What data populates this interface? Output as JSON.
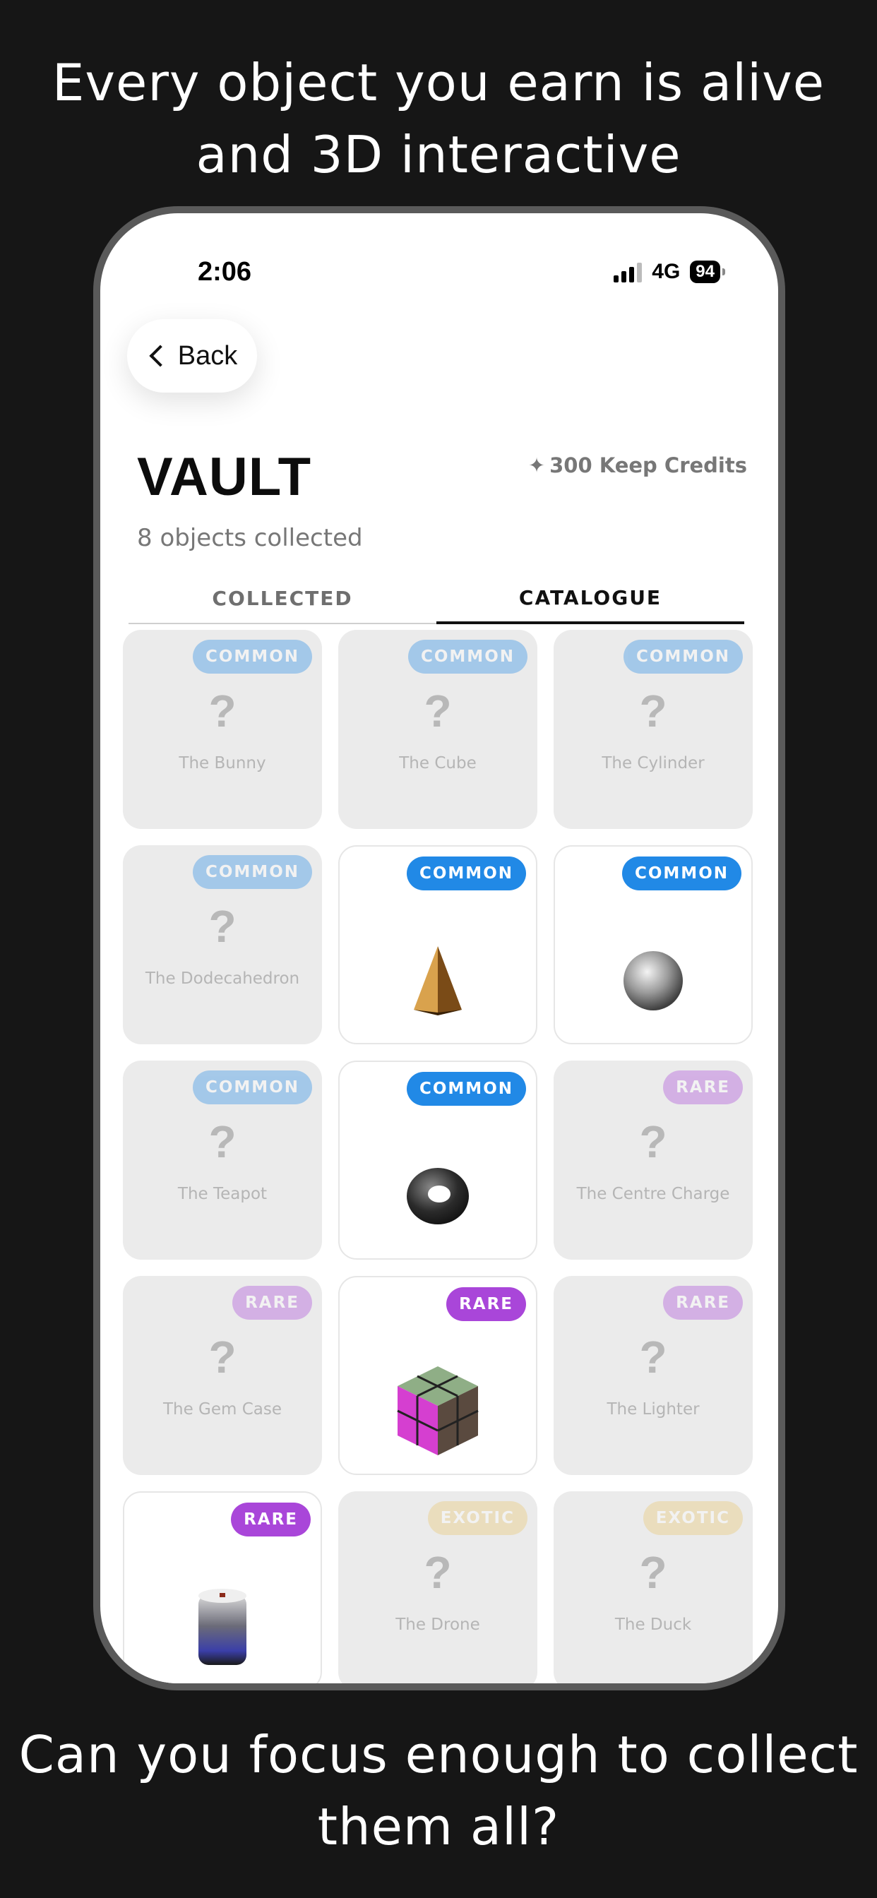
{
  "headline_top": [
    "Every object you earn is alive",
    "and 3D interactive"
  ],
  "headline_bottom": [
    "Can you focus enough to collect",
    "them all?"
  ],
  "status": {
    "time": "2:06",
    "network": "4G",
    "battery": "94"
  },
  "back_button": {
    "label": "Back",
    "icon": "chevron-left-icon"
  },
  "vault": {
    "title": "VAULT",
    "subtitle": "8 objects collected",
    "credits": "300 Keep Credits",
    "credits_icon": "sparkle-icon"
  },
  "tabs": [
    {
      "label": "COLLECTED",
      "active": false
    },
    {
      "label": "CATALOGUE",
      "active": true
    }
  ],
  "rarity_colors": {
    "COMMON": "#2189e6",
    "RARE": "#a946d9",
    "EXOTIC": "#e9c46a"
  },
  "items": [
    {
      "name": "The Bunny",
      "rarity": "COMMON",
      "owned": false
    },
    {
      "name": "The Cube",
      "rarity": "COMMON",
      "owned": false
    },
    {
      "name": "The Cylinder",
      "rarity": "COMMON",
      "owned": false
    },
    {
      "name": "The Dodecahedron",
      "rarity": "COMMON",
      "owned": false
    },
    {
      "name": "",
      "rarity": "COMMON",
      "owned": true,
      "object": "pyramid"
    },
    {
      "name": "",
      "rarity": "COMMON",
      "owned": true,
      "object": "sphere"
    },
    {
      "name": "The Teapot",
      "rarity": "COMMON",
      "owned": false
    },
    {
      "name": "",
      "rarity": "COMMON",
      "owned": true,
      "object": "torus"
    },
    {
      "name": "The Centre Charge",
      "rarity": "RARE",
      "owned": false
    },
    {
      "name": "The Gem Case",
      "rarity": "RARE",
      "owned": false
    },
    {
      "name": "",
      "rarity": "RARE",
      "owned": true,
      "object": "rubik-cube"
    },
    {
      "name": "The Lighter",
      "rarity": "RARE",
      "owned": false
    },
    {
      "name": "",
      "rarity": "RARE",
      "owned": true,
      "object": "canister"
    },
    {
      "name": "The Drone",
      "rarity": "EXOTIC",
      "owned": false
    },
    {
      "name": "The Duck",
      "rarity": "EXOTIC",
      "owned": false
    }
  ],
  "locked_symbol": "?"
}
